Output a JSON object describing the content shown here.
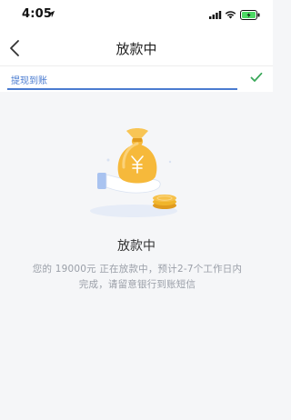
{
  "status_bar": {
    "time": "4:05"
  },
  "nav": {
    "title": "放款中"
  },
  "progress": {
    "label": "提现到账",
    "completed": true
  },
  "status": {
    "title": "放款中",
    "description": "您的 19000元 正在放款中，预计2-7个工作日内完成，请留意银行到账短信"
  },
  "icons": {
    "location": "location-arrow-icon",
    "signal": "signal-icon",
    "wifi": "wifi-icon",
    "battery": "battery-charging-icon",
    "back": "back-chevron-icon",
    "check": "check-icon",
    "illustration": "money-bag-hand-icon"
  },
  "colors": {
    "accent": "#4a7bd0",
    "check": "#3aa85a",
    "bag": "#f6b93b",
    "coin": "#f0b52b",
    "battery": "#4cd964"
  }
}
